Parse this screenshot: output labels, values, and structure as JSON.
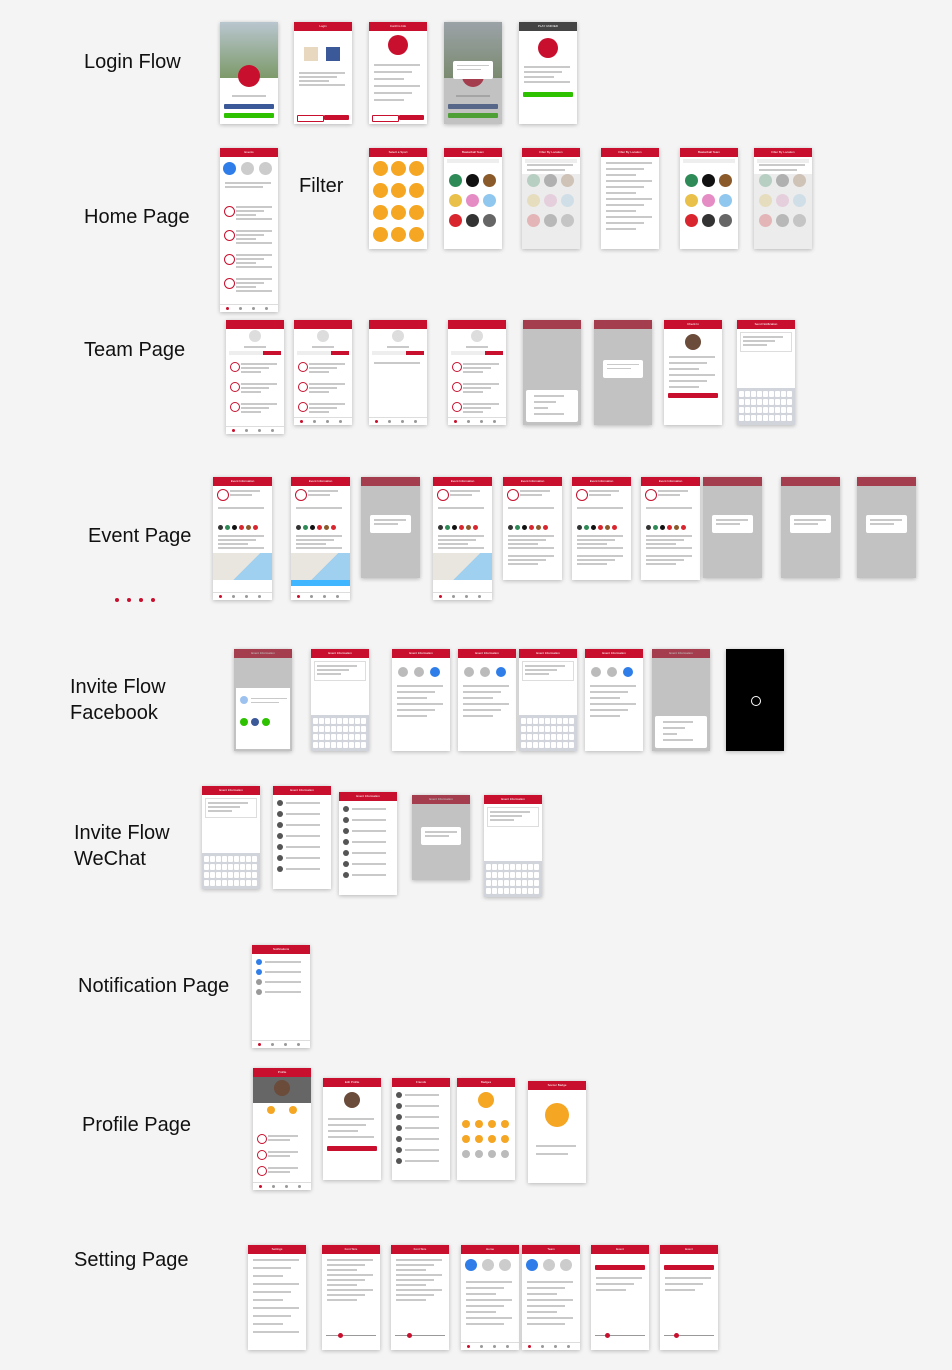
{
  "colors": {
    "brand_red": "#c8102e",
    "filter_orange": "#f5a623",
    "facebook_blue": "#3b5998",
    "wechat_green": "#2dc100",
    "background": "#f4f4f4"
  },
  "sections": [
    {
      "label": "Login Flow",
      "screens": [
        {
          "title": ""
        },
        {
          "title": "Login"
        },
        {
          "title": "Confirm Info"
        },
        {
          "title": ""
        },
        {
          "title": "PLAY UNIFIED"
        }
      ]
    },
    {
      "label": "Home Page",
      "screens": [
        {
          "title": "Events"
        }
      ]
    },
    {
      "label": "Filter",
      "screens": [
        {
          "title": "Select a Sport"
        },
        {
          "title": "Basketball Team"
        },
        {
          "title": "Filter By Location"
        },
        {
          "title": "Filter By Location"
        },
        {
          "title": "Basketball Team"
        },
        {
          "title": "Filter By Location"
        }
      ]
    },
    {
      "label": "Team Page",
      "screens": [
        {
          "title": ""
        },
        {
          "title": ""
        },
        {
          "title": ""
        },
        {
          "title": ""
        },
        {
          "title": ""
        },
        {
          "title": ""
        },
        {
          "title": "Check In"
        },
        {
          "title": "Send Notification"
        }
      ]
    },
    {
      "label": "Event Page",
      "screens": [
        {
          "title": "Event Information"
        },
        {
          "title": "Event Information"
        },
        {
          "title": ""
        },
        {
          "title": "Event Information"
        },
        {
          "title": "Event Information"
        },
        {
          "title": "Event Information"
        },
        {
          "title": "Event Information"
        },
        {
          "title": ""
        },
        {
          "title": ""
        },
        {
          "title": ""
        }
      ]
    },
    {
      "label": "Invite Flow\nFacebook",
      "screens": [
        {
          "title": "Event Information"
        },
        {
          "title": "Event Information"
        },
        {
          "title": "Event Information"
        },
        {
          "title": "Event Information"
        },
        {
          "title": "Event Information"
        },
        {
          "title": "Event Information"
        },
        {
          "title": "Event Information"
        },
        {
          "title": "Event Information"
        }
      ]
    },
    {
      "label": "Invite Flow\nWeChat",
      "screens": [
        {
          "title": "Event Information"
        },
        {
          "title": "Event Information"
        },
        {
          "title": "Event Information"
        },
        {
          "title": "Event Information"
        },
        {
          "title": "Event Information"
        }
      ]
    },
    {
      "label": "Notification Page",
      "screens": [
        {
          "title": "Notifications"
        }
      ]
    },
    {
      "label": "Profile Page",
      "screens": [
        {
          "title": "Profile"
        },
        {
          "title": "Edit Profile"
        },
        {
          "title": "Friends"
        },
        {
          "title": "Badges"
        },
        {
          "title": "Soccer Badge"
        }
      ]
    },
    {
      "label": "Setting Page",
      "screens": [
        {
          "title": "Settings"
        },
        {
          "title": "Font Size"
        },
        {
          "title": "Font Size"
        },
        {
          "title": "Home"
        },
        {
          "title": "Team"
        },
        {
          "title": "Event"
        },
        {
          "title": "Event"
        }
      ]
    }
  ]
}
